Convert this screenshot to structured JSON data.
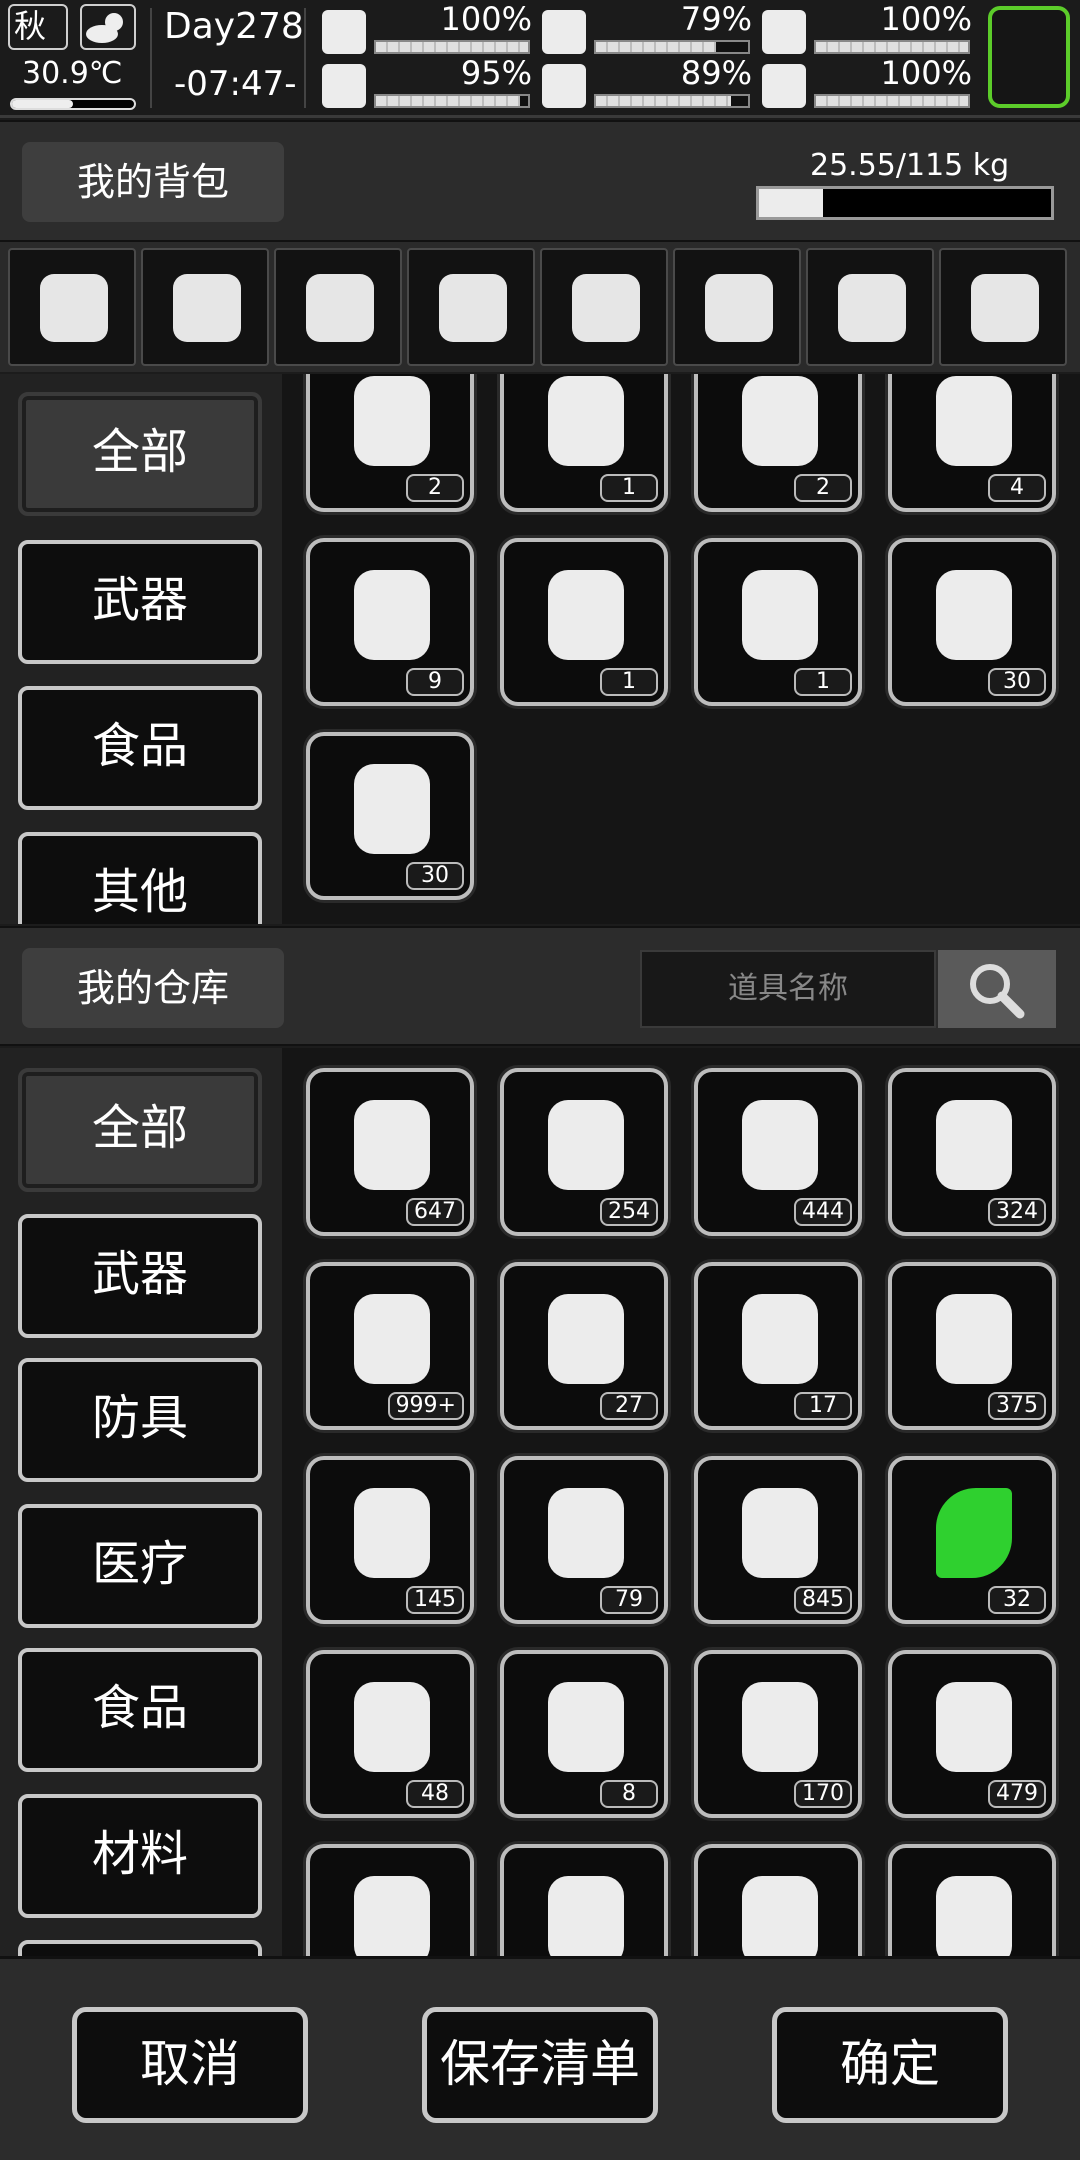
{
  "status": {
    "season": "秋",
    "temperature": "30.9℃",
    "temp_level": 0.5,
    "day": "Day278",
    "time": "-07:47-",
    "stats": [
      {
        "icon": "medkit-icon",
        "value": "100%",
        "level": 1.0
      },
      {
        "icon": "stomach-icon",
        "value": "79%",
        "level": 0.79
      },
      {
        "icon": "pill-icon",
        "value": "100%",
        "level": 1.0
      },
      {
        "icon": "boot-icon",
        "value": "95%",
        "level": 0.95
      },
      {
        "icon": "water-drop-icon",
        "value": "89%",
        "level": 0.89
      },
      {
        "icon": "heart-icon",
        "value": "100%",
        "level": 1.0
      }
    ]
  },
  "backpack": {
    "title": "我的背包",
    "weight": "25.55/115 kg",
    "weight_level": 0.22,
    "equipment": [
      "ghillie-helmet-net-icon",
      "pistol-icon",
      "rifle-icon",
      "vest-plate-icon",
      "arm-guards-icon",
      "body-armor-icon",
      "helmet-icon",
      "backpack-icon"
    ],
    "categories": [
      "全部",
      "武器",
      "食品",
      "其他"
    ],
    "items": [
      {
        "icon": "towel-icon",
        "count": "2"
      },
      {
        "icon": "bread-icon",
        "count": "1"
      },
      {
        "icon": "water-bottle-icon",
        "count": "2"
      },
      {
        "icon": "rope-icon",
        "count": "4"
      },
      {
        "icon": "net-icon",
        "count": "9"
      },
      {
        "icon": "axe-icon",
        "count": "1"
      },
      {
        "icon": "shovel-icon",
        "count": "1"
      },
      {
        "icon": "rifle-ammo-icon",
        "count": "30"
      },
      {
        "icon": "pistol-ammo-icon",
        "count": "30"
      }
    ]
  },
  "warehouse": {
    "title": "我的仓库",
    "search_placeholder": "道具名称",
    "categories": [
      "全部",
      "武器",
      "防具",
      "医疗",
      "食品",
      "材料"
    ],
    "items": [
      {
        "icon": "logs-icon",
        "count": "647"
      },
      {
        "icon": "spray-bottle-icon",
        "count": "254"
      },
      {
        "icon": "fertilizer-bag-icon",
        "count": "444"
      },
      {
        "icon": "glass-bottle-icon",
        "count": "324"
      },
      {
        "icon": "car-battery-icon",
        "count": "999+"
      },
      {
        "icon": "aa-battery-icon",
        "count": "27"
      },
      {
        "icon": "seeds-icon",
        "count": "17"
      },
      {
        "icon": "mesh-filter-icon",
        "count": "375"
      },
      {
        "icon": "rope-icon",
        "count": "145"
      },
      {
        "icon": "knife-icon",
        "count": "79"
      },
      {
        "icon": "plastic-bottle-icon",
        "count": "845"
      },
      {
        "icon": "herb-leaves-icon",
        "count": "32",
        "green": true
      },
      {
        "icon": "nuts-icon",
        "count": "48"
      },
      {
        "icon": "cloth-scrap-icon",
        "count": "8"
      },
      {
        "icon": "potato-plant-icon",
        "count": "170"
      },
      {
        "icon": "fabric-icon",
        "count": "479"
      },
      {
        "icon": "towel-icon",
        "count": ""
      },
      {
        "icon": "rubble-icon",
        "count": ""
      },
      {
        "icon": "meat-icon",
        "count": ""
      },
      {
        "icon": "bread-icon",
        "count": ""
      }
    ]
  },
  "footer": {
    "cancel": "取消",
    "save_list": "保存清单",
    "confirm": "确定"
  }
}
